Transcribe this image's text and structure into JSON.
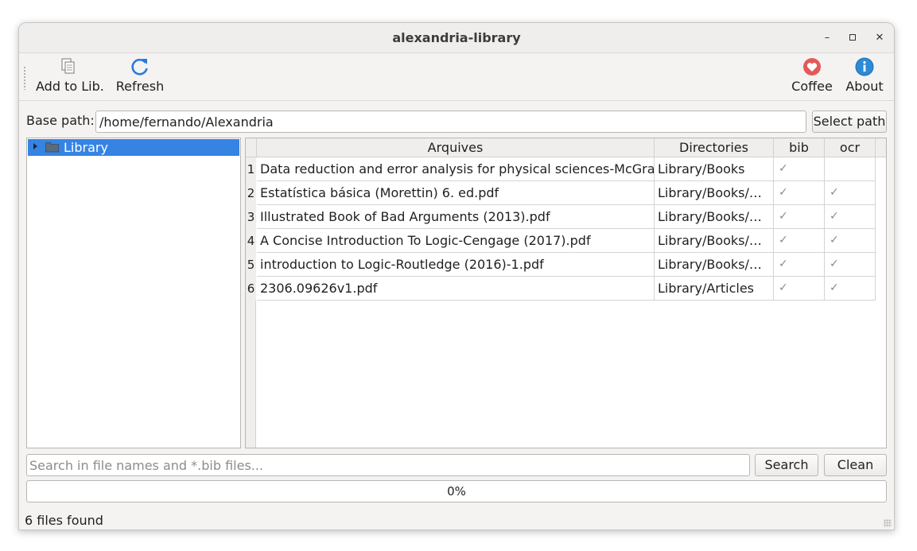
{
  "window": {
    "title": "alexandria-library"
  },
  "toolbar": {
    "add_label": "Add to Lib.",
    "refresh_label": "Refresh",
    "coffee_label": "Coffee",
    "about_label": "About"
  },
  "base_path": {
    "label": "Base path:",
    "value": "/home/fernando/Alexandria",
    "select_label": "Select path"
  },
  "tree": {
    "items": [
      {
        "label": "Library",
        "icon": "folder-icon",
        "selected": true
      }
    ]
  },
  "table": {
    "headers": [
      "Arquives",
      "Directories",
      "bib",
      "ocr"
    ],
    "rows": [
      {
        "num": "1",
        "file": "Data reduction and error analysis for physical sciences-McGraw-",
        "dir": "Library/Books",
        "bib": "✓",
        "ocr": ""
      },
      {
        "num": "2",
        "file": "Estatística básica (Morettin) 6. ed.pdf",
        "dir": "Library/Books/…",
        "bib": "✓",
        "ocr": "✓"
      },
      {
        "num": "3",
        "file": "Illustrated Book of Bad Arguments (2013).pdf",
        "dir": "Library/Books/…",
        "bib": "✓",
        "ocr": "✓"
      },
      {
        "num": "4",
        "file": "A Concise Introduction To Logic-Cengage (2017).pdf",
        "dir": "Library/Books/…",
        "bib": "✓",
        "ocr": "✓"
      },
      {
        "num": "5",
        "file": "introduction to Logic-Routledge (2016)-1.pdf",
        "dir": "Library/Books/…",
        "bib": "✓",
        "ocr": "✓"
      },
      {
        "num": "6",
        "file": "2306.09626v1.pdf",
        "dir": "Library/Articles",
        "bib": "✓",
        "ocr": "✓"
      }
    ]
  },
  "search": {
    "placeholder": "Search in file names and *.bib files...",
    "value": "",
    "search_label": "Search",
    "clean_label": "Clean"
  },
  "progress": {
    "value": 0,
    "label": "0%"
  },
  "status": {
    "text": "6 files found"
  },
  "colors": {
    "accent": "#3584e4",
    "coffee": "#e35a5a",
    "about": "#2d8ad6",
    "refresh": "#2a7bd8"
  }
}
